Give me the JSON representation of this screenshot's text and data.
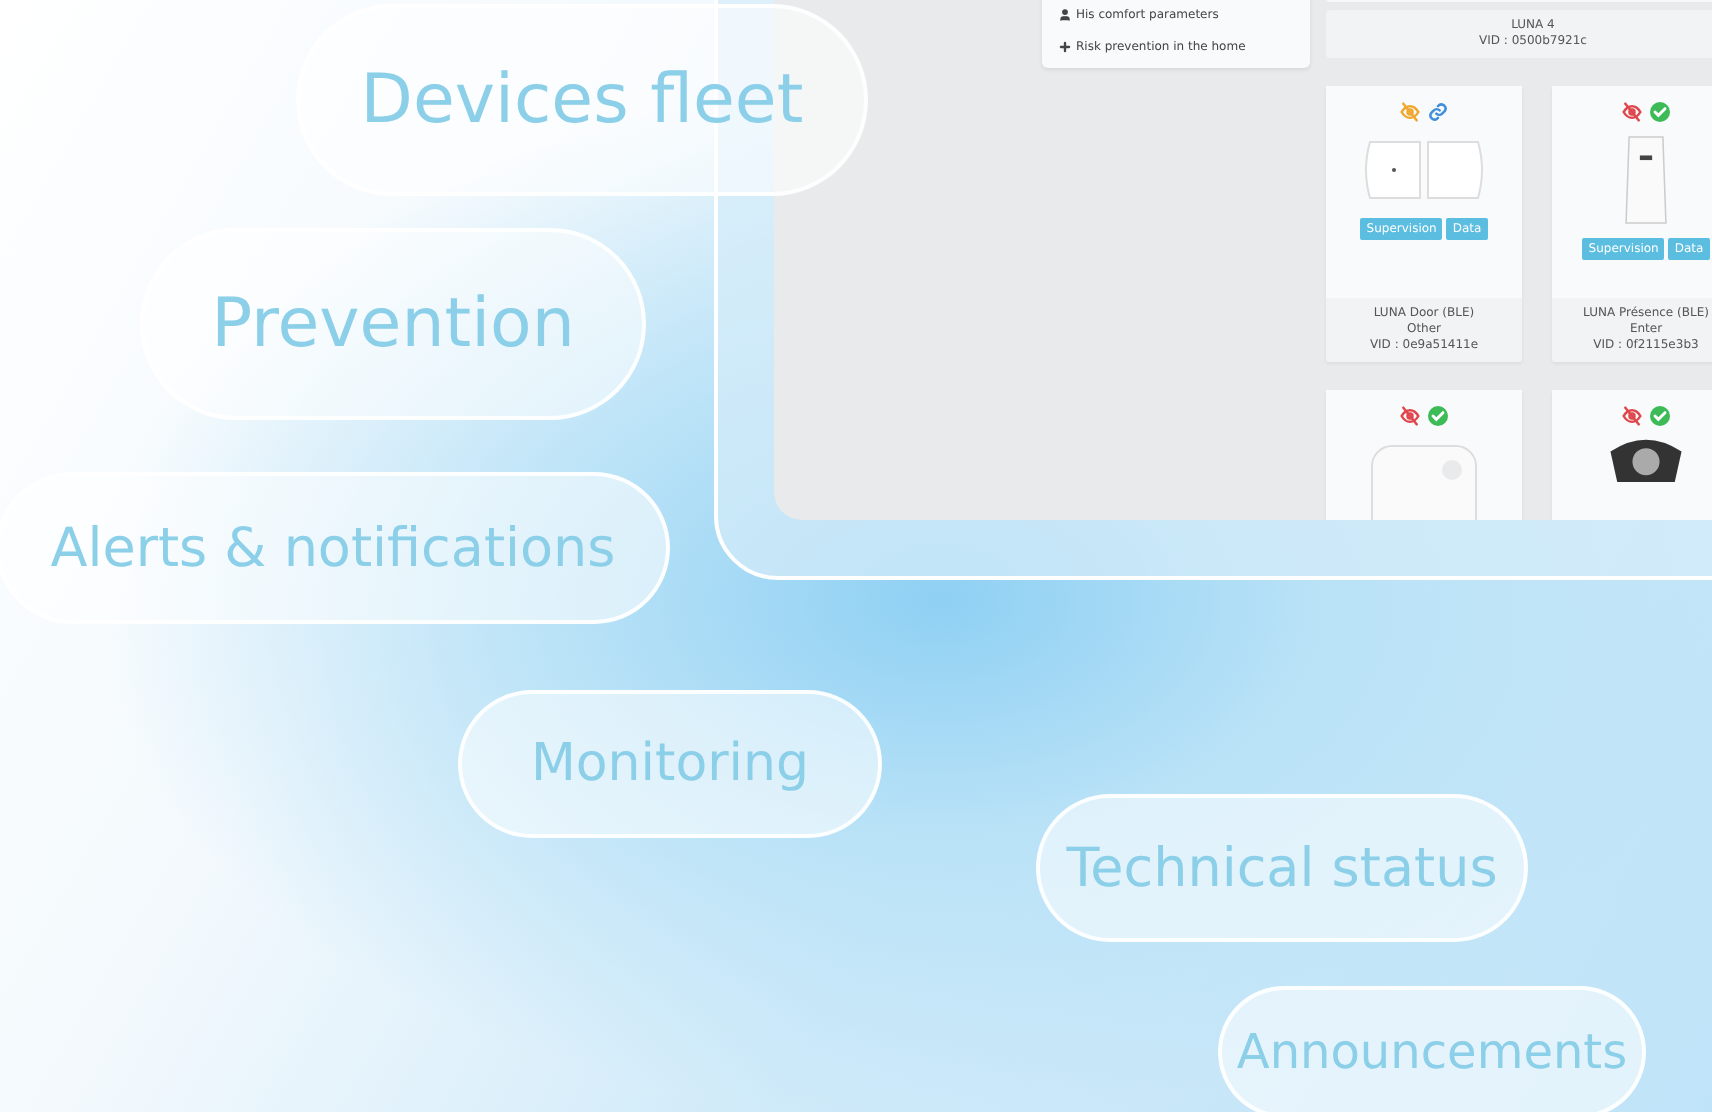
{
  "screen": {
    "menu": [
      {
        "kind": "user",
        "label": "His comfort parameters"
      },
      {
        "kind": "cross",
        "label": "Risk prevention in the home"
      }
    ],
    "top_device": {
      "name": "LUNA 4",
      "vid": "VID : 0500b7921c"
    },
    "devices": [
      {
        "kind": "door",
        "color": "#f0a830",
        "linked": true,
        "buttons": [
          "Supervision",
          "Data"
        ],
        "name": "LUNA Door (BLE)",
        "type": "Other",
        "vid": "VID : 0e9a51411e"
      },
      {
        "kind": "presence",
        "color": "#e0474c",
        "linked": false,
        "buttons": [
          "Supervision",
          "Data"
        ],
        "name": "LUNA Présence (BLE)",
        "type": "Enter",
        "vid": "VID : 0f2115e3b3"
      },
      {
        "kind": "tag",
        "color": "#e0474c",
        "linked": false
      },
      {
        "kind": "band",
        "color": "#e0474c",
        "linked": false
      }
    ]
  },
  "features": [
    "Devices fleet",
    "Prevention",
    "Alerts & notifications",
    "Monitoring",
    "Technical status",
    "Announcements"
  ]
}
